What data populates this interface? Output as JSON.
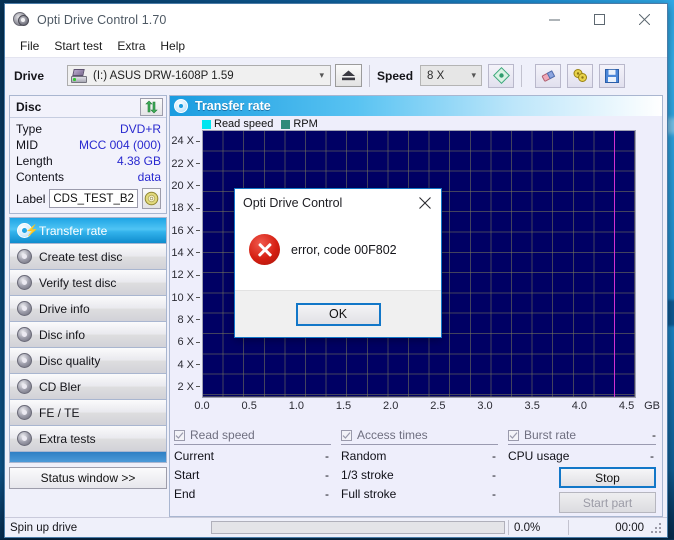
{
  "window": {
    "title": "Opti Drive Control 1.70",
    "icon": "optical-disc-icon",
    "minimize": "minimize-icon",
    "maximize": "maximize-icon",
    "close": "close-icon"
  },
  "menu": {
    "items": [
      "File",
      "Start test",
      "Extra",
      "Help"
    ]
  },
  "toolbar": {
    "drive_label": "Drive",
    "drive_value": "(I:)  ASUS DRW-1608P 1.59",
    "drive_icon": "optical-drive-icon",
    "eject_label": "eject-icon",
    "speed_label": "Speed",
    "speed_value": "8 X",
    "buttons": [
      "settings-icon",
      "eraser-icon",
      "bitsetting-icon",
      "save-icon"
    ]
  },
  "disc_panel": {
    "header": "Disc",
    "refresh_icon": "refresh-arrows-icon",
    "rows": [
      {
        "key": "Type",
        "value": "DVD+R"
      },
      {
        "key": "MID",
        "value": "MCC 004 (000)"
      },
      {
        "key": "Length",
        "value": "4.38 GB"
      },
      {
        "key": "Contents",
        "value": "data"
      }
    ],
    "label_key": "Label",
    "label_value": "CDS_TEST_B2",
    "label_button_icon": "cd-disc-icon"
  },
  "nav": {
    "items": [
      {
        "label": "Transfer rate",
        "selected": true
      },
      {
        "label": "Create test disc",
        "selected": false
      },
      {
        "label": "Verify test disc",
        "selected": false
      },
      {
        "label": "Drive info",
        "selected": false
      },
      {
        "label": "Disc info",
        "selected": false
      },
      {
        "label": "Disc quality",
        "selected": false
      },
      {
        "label": "CD Bler",
        "selected": false
      },
      {
        "label": "FE / TE",
        "selected": false
      },
      {
        "label": "Extra tests",
        "selected": false
      }
    ],
    "status_window_button": "Status window >>"
  },
  "chart_panel": {
    "title": "Transfer rate",
    "title_icon": "disc-speed-icon"
  },
  "chart_data": {
    "type": "line",
    "title": "Transfer rate",
    "xlabel": "GB",
    "ylabel": "",
    "xlim": [
      0.0,
      4.6
    ],
    "ylim": [
      1.0,
      25.0
    ],
    "grid": true,
    "legend_position": "top-left",
    "xticks": [
      "0.0",
      "0.5",
      "1.0",
      "1.5",
      "2.0",
      "2.5",
      "3.0",
      "3.5",
      "4.0",
      "4.5"
    ],
    "xtick_values": [
      0.0,
      0.5,
      1.0,
      1.5,
      2.0,
      2.5,
      3.0,
      3.5,
      4.0,
      4.5
    ],
    "x_unit": "GB",
    "yticks": [
      "2 X",
      "4 X",
      "6 X",
      "8 X",
      "10 X",
      "12 X",
      "14 X",
      "16 X",
      "18 X",
      "20 X",
      "22 X",
      "24 X"
    ],
    "ytick_values": [
      2,
      4,
      6,
      8,
      10,
      12,
      14,
      16,
      18,
      20,
      22,
      24
    ],
    "series": [
      {
        "name": "Read speed",
        "color": "#00e5f0",
        "x": [],
        "values": []
      },
      {
        "name": "RPM",
        "color": "#2e8b7a",
        "x": [],
        "values": []
      }
    ],
    "annotations": [
      {
        "name": "disc-capacity-marker",
        "type": "vline",
        "x": 4.38,
        "color": "#d030d0"
      }
    ],
    "plot_background": "#000064",
    "grid_color": "#6e6e5a"
  },
  "stats": {
    "read_speed": {
      "checkbox_label": "Read speed",
      "checked": true,
      "rows": [
        {
          "key": "Current",
          "value": "-"
        },
        {
          "key": "Start",
          "value": "-"
        },
        {
          "key": "End",
          "value": "-"
        }
      ]
    },
    "access_times": {
      "checkbox_label": "Access times",
      "checked": true,
      "rows": [
        {
          "key": "Random",
          "value": "-"
        },
        {
          "key": "1/3 stroke",
          "value": "-"
        },
        {
          "key": "Full stroke",
          "value": "-"
        }
      ]
    },
    "burst_rate": {
      "checkbox_label": "Burst rate",
      "checked": true,
      "value": "-",
      "cpu_key": "CPU usage",
      "cpu_value": "-"
    },
    "stop_button": "Stop",
    "start_part_button": "Start part"
  },
  "statusbar": {
    "message": "Spin up drive",
    "progress_percent": "0.0%",
    "progress_value": 0,
    "elapsed": "00:00"
  },
  "dialog": {
    "title": "Opti Drive Control",
    "close_icon": "close-icon",
    "error_icon": "error-circle-icon",
    "message": "error, code 00F802",
    "ok_button": "OK"
  }
}
